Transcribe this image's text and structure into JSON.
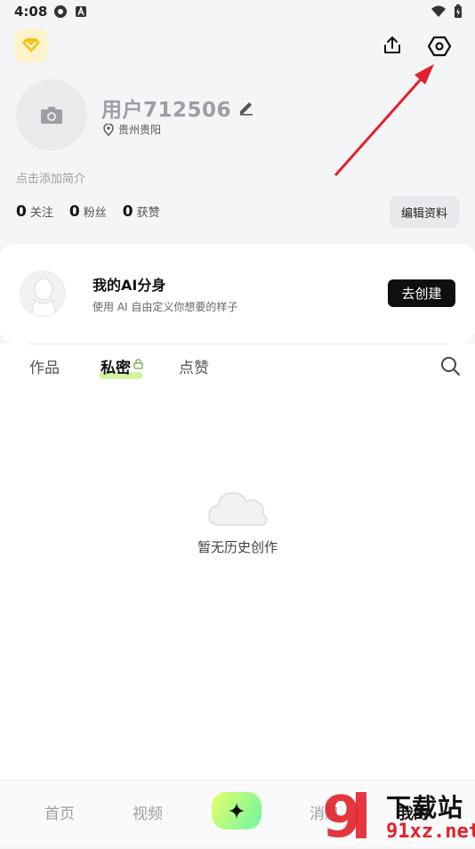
{
  "status_bar": {
    "time": "4:08"
  },
  "header": {
    "vip_icon": "vip-diamond-icon",
    "share_icon": "share-icon",
    "settings_icon": "settings-hexagon-icon"
  },
  "profile": {
    "username": "用户712506",
    "location": "贵州贵阳",
    "bio_placeholder": "点击添加简介",
    "stats": [
      {
        "count": "0",
        "label": "关注"
      },
      {
        "count": "0",
        "label": "粉丝"
      },
      {
        "count": "0",
        "label": "获赞"
      }
    ],
    "edit_button": "编辑资料"
  },
  "ai_card": {
    "title": "我的AI分身",
    "description": "使用 AI 自由定义你想要的样子",
    "button": "去创建"
  },
  "tabs": [
    {
      "label": "作品"
    },
    {
      "label": "私密"
    },
    {
      "label": "点赞"
    }
  ],
  "empty_state": {
    "text": "暂无历史创作"
  },
  "bottom_nav": {
    "home": "首页",
    "video": "视频",
    "messages": "消息",
    "me": "我的"
  },
  "watermark": {
    "line1": "下载站",
    "line2": "91xz.net"
  },
  "colors": {
    "accent_green": "#c9f08a",
    "annotation_red": "#e3202b",
    "vip_yellow": "#f5c518"
  }
}
